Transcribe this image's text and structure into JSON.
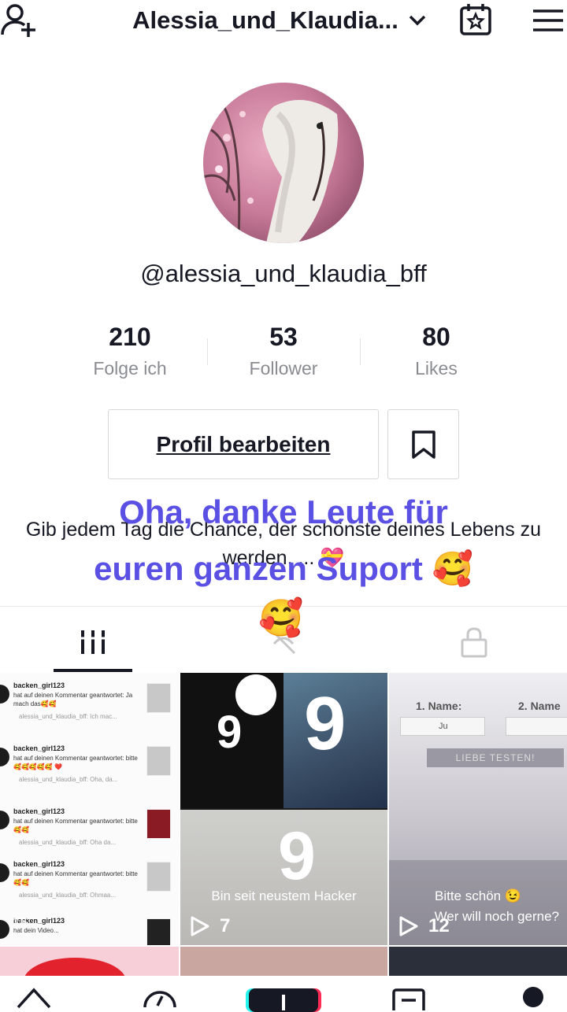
{
  "topbar": {
    "title": "Alessia_und_Klaudia...",
    "add_user_icon": "person-plus",
    "calendar_icon": "calendar-star",
    "menu_icon": "hamburger"
  },
  "profile": {
    "handle": "@alessia_und_klaudia_bff",
    "stats": [
      {
        "value": "210",
        "label": "Folge ich"
      },
      {
        "value": "53",
        "label": "Follower"
      },
      {
        "value": "80",
        "label": "Likes"
      }
    ],
    "edit_button": "Profil bearbeiten",
    "bio": "Gib jedem Tag die Chance, der schönste deines Lebens zu werden. ... 💝"
  },
  "overlay_text": {
    "line1": "Oha, danke Leute für",
    "line2": "euren ganzen Suport 🥰",
    "emoji": "🥰"
  },
  "videos": [
    {
      "comments": [
        {
          "user": "backen_girl123",
          "text": "hat auf deinen Kommentar geantwortet: Ja mach das🥰🥰",
          "reply": "alessia_und_klaudia_bff: Ich mac..."
        },
        {
          "user": "backen_girl123",
          "text": "hat auf deinen Kommentar geantwortet: bitte🥰🥰🥰🥰🥰 ❤️",
          "reply": "alessia_und_klaudia_bff: Oha, da..."
        },
        {
          "user": "backen_girl123",
          "text": "hat auf deinen Kommentar geantwortet: bitte🥰🥰",
          "reply": "alessia_und_klaudia_bff: Oha da..."
        },
        {
          "user": "backen_girl123",
          "text": "hat auf deinen Kommentar geantwortet: bitte🥰🥰",
          "reply": "alessia_und_klaudia_bff: Ohmaa..."
        },
        {
          "user": "backen_girl123",
          "text": "hat dein Video..."
        }
      ],
      "views": "15"
    },
    {
      "caption": "Bin seit neustem Hacker",
      "views": "7"
    },
    {
      "caption_line1": "Bitte schön 😉",
      "caption_line2": "Wer will noch gerne?",
      "views": "12",
      "form_labels": [
        "1. Name:",
        "2. Name"
      ],
      "form_input": "Ju",
      "form_button": "LIEBE TESTEN!"
    }
  ],
  "colors": {
    "accent_text": "#5b50e4",
    "primary_text": "#161823",
    "secondary_text": "#8a8b91"
  }
}
